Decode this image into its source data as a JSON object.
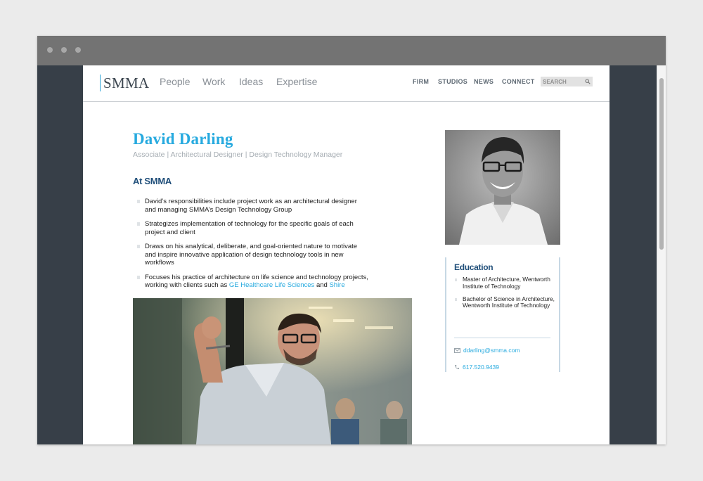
{
  "nav": {
    "logo": "SMMA",
    "main": [
      "People",
      "Work",
      "Ideas",
      "Expertise"
    ],
    "secondary": [
      "FIRM",
      "STUDIOS",
      "NEWS",
      "CONNECT"
    ],
    "search_placeholder": "SEARCH",
    "search_icon": "search-icon"
  },
  "profile": {
    "name": "David Darling",
    "title": "Associate | Architectural Designer | Design Technology Manager",
    "section_heading": "At SMMA",
    "bullets": [
      "David’s responsibilities include project work as an architectural designer and managing SMMA’s Design Technology Group",
      "Strategizes implementation of technology for the specific goals of each project and client",
      "Draws on his analytical, deliberate, and goal-oriented nature to motivate and inspire innovative application of design technology tools in new workflows"
    ],
    "last_bullet": {
      "text_before": "Focuses his practice of architecture on life science and technology projects, working with clients such as ",
      "link1": "GE Healthcare Life Sciences",
      "text_middle": " and ",
      "link2": "Shire"
    }
  },
  "sidebar": {
    "heading": "Education",
    "education": [
      "Master of Architecture, Wentworth Institute of Technology",
      "Bachelor of Science in Architecture, Wentworth Institute of Technology"
    ],
    "email": "ddarling@smma.com",
    "phone": "617.520.9439",
    "email_icon": "envelope-icon",
    "phone_icon": "phone-icon"
  },
  "colors": {
    "accent": "#27aadf",
    "heading": "#1f4e79",
    "frame": "#373f48",
    "titlebar": "#737373"
  }
}
